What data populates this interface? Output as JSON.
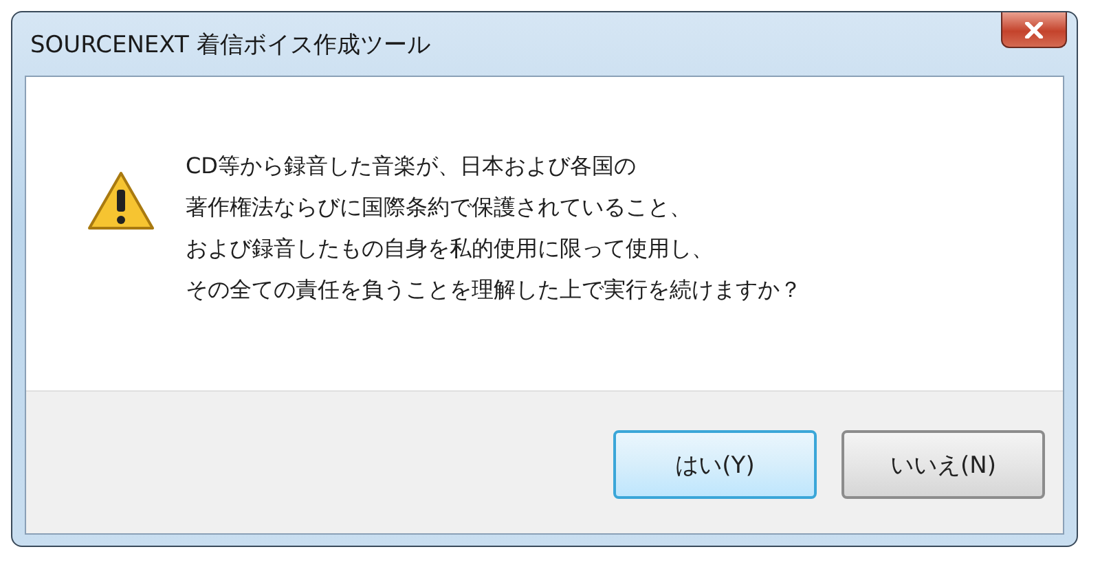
{
  "window": {
    "title": "SOURCENEXT 着信ボイス作成ツール"
  },
  "message": {
    "lines": [
      "CD等から録音した音楽が、日本および各国の",
      "著作権法ならびに国際条約で保護されていること、",
      "および録音したもの自身を私的使用に限って使用し、",
      "その全ての責任を負うことを理解した上で実行を続けますか？"
    ]
  },
  "buttons": [
    {
      "label": "はい(Y)",
      "selected": true
    },
    {
      "label": "いいえ(N)",
      "selected": false
    }
  ]
}
